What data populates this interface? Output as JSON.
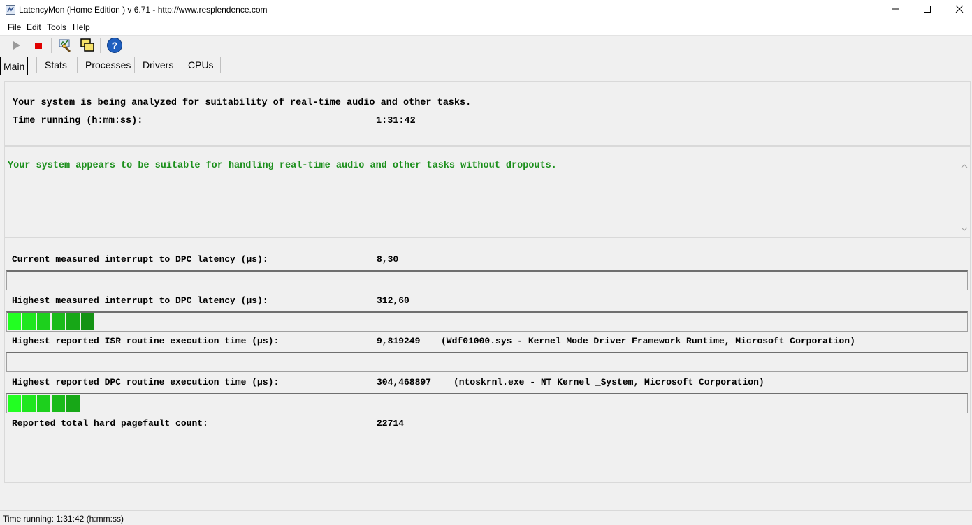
{
  "window": {
    "title": "LatencyMon  (Home Edition )  v 6.71 - http://www.resplendence.com",
    "minimize": "—",
    "maximize": "☐",
    "close": "✕"
  },
  "menu": [
    "File",
    "Edit",
    "Tools",
    "Help"
  ],
  "toolbar": {
    "icons": [
      "play-icon",
      "stop-icon",
      "analyze-icon",
      "windows-icon",
      "help-icon"
    ],
    "colors": {
      "play": "#9a9a9a",
      "stop": "#e00000",
      "help": "#1f5fbf"
    }
  },
  "tabs": [
    "Main",
    "Stats",
    "Processes",
    "Drivers",
    "CPUs"
  ],
  "summary": {
    "headline": "Your system is being analyzed for suitability of real-time audio and other tasks.",
    "time_label": "Time running (h:mm:ss):",
    "time_value": "1:31:42"
  },
  "verdict": {
    "text": "Your system appears to be suitable for handling real-time audio and other tasks without dropouts.",
    "color": "#1b8f1b"
  },
  "metrics": [
    {
      "label": "Current measured interrupt to DPC latency (µs):",
      "value": "8,30",
      "detail": "",
      "bar_level": 0
    },
    {
      "label": "Highest measured interrupt to DPC latency (µs):",
      "value": "312,60",
      "detail": "",
      "bar_level": 6
    },
    {
      "label": "Highest reported ISR routine execution time (µs):",
      "value": "9,819249",
      "detail": "(Wdf01000.sys - Kernel Mode Driver Framework Runtime, Microsoft Corporation)",
      "bar_level": 0
    },
    {
      "label": "Highest reported DPC routine execution time (µs):",
      "value": "304,468897",
      "detail": "(ntoskrnl.exe - NT Kernel _System, Microsoft Corporation)",
      "bar_level": 5
    },
    {
      "label": "Reported total hard pagefault count:",
      "value": "22714",
      "detail": ""
    }
  ],
  "bar_colors": [
    "#22ff22",
    "#1fe61f",
    "#1dd01d",
    "#1abb1a",
    "#17a717",
    "#149314"
  ],
  "status": "Time running: 1:31:42  (h:mm:ss)"
}
